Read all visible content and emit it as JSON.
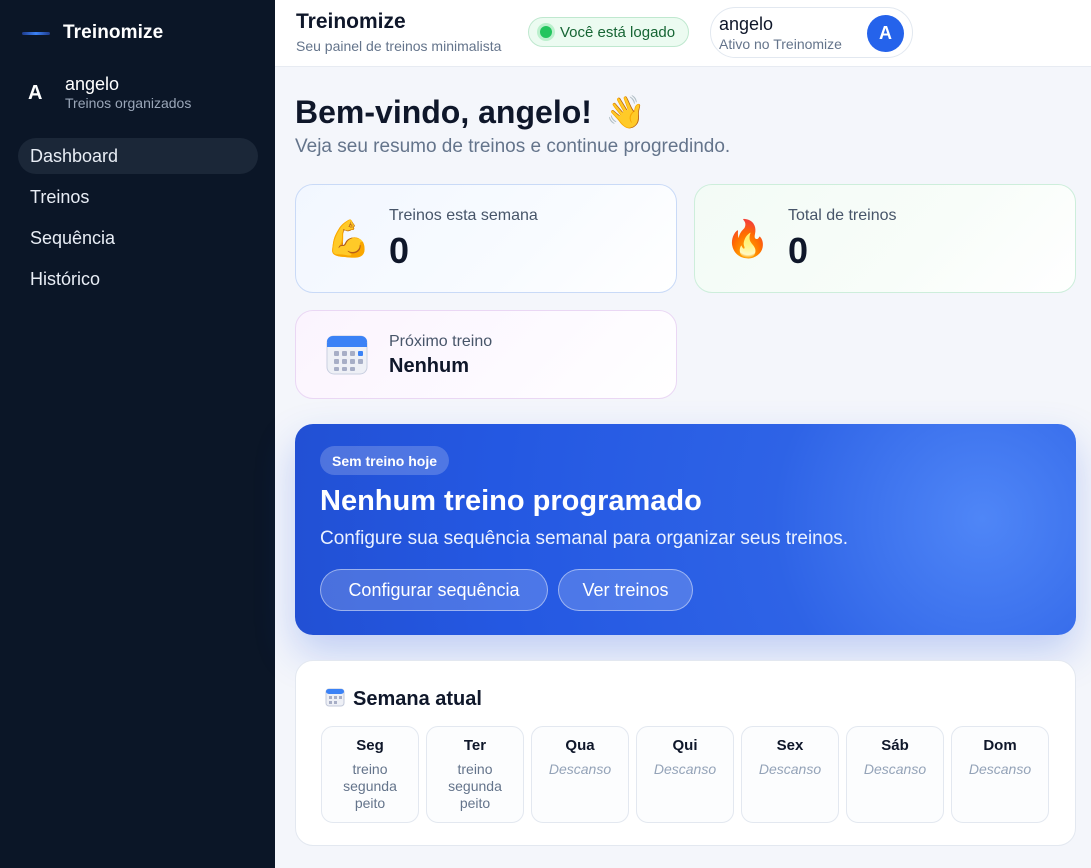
{
  "sidebar": {
    "brand": "Treinomize",
    "user": {
      "initial": "A",
      "name": "angelo",
      "subtitle": "Treinos organizados"
    },
    "nav": [
      {
        "label": "Dashboard",
        "active": true
      },
      {
        "label": "Treinos",
        "active": false
      },
      {
        "label": "Sequência",
        "active": false
      },
      {
        "label": "Histórico",
        "active": false
      }
    ]
  },
  "topbar": {
    "title": "Treinomize",
    "subtitle": "Seu painel de treinos minimalista",
    "status": "Você está logado",
    "account": {
      "name": "angelo",
      "subtitle": "Ativo no Treinomize",
      "initial": "A"
    }
  },
  "main": {
    "welcome": "Bem-vindo, angelo!",
    "welcome_icon": "👋",
    "subtitle": "Veja seu resumo de treinos e continue progredindo.",
    "stats": {
      "week": {
        "label": "Treinos esta semana",
        "value": "0",
        "icon": "💪"
      },
      "total": {
        "label": "Total de treinos",
        "value": "0",
        "icon": "🔥"
      },
      "next": {
        "label": "Próximo treino",
        "value": "Nenhum",
        "icon": "calendar-icon"
      }
    },
    "hero": {
      "badge": "Sem treino hoje",
      "title": "Nenhum treino programado",
      "subtitle": "Configure sua sequência semanal para organizar seus treinos.",
      "btn_config": "Configurar sequência",
      "btn_view": "Ver treinos"
    },
    "week": {
      "title": "Semana atual",
      "days": [
        {
          "name": "Seg",
          "workout": "treino segunda peito",
          "rest": false
        },
        {
          "name": "Ter",
          "workout": "treino segunda peito",
          "rest": false
        },
        {
          "name": "Qua",
          "workout": "Descanso",
          "rest": true
        },
        {
          "name": "Qui",
          "workout": "Descanso",
          "rest": true
        },
        {
          "name": "Sex",
          "workout": "Descanso",
          "rest": true
        },
        {
          "name": "Sáb",
          "workout": "Descanso",
          "rest": true
        },
        {
          "name": "Dom",
          "workout": "Descanso",
          "rest": true
        }
      ]
    }
  },
  "colors": {
    "sidebar_bg": "#0b1627",
    "accent": "#2563eb",
    "success": "#22c55e"
  }
}
